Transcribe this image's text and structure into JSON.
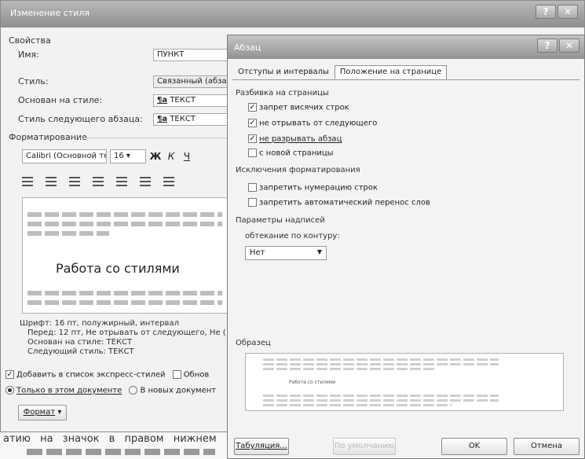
{
  "bg_dialog": {
    "title": "Изменение стиля",
    "properties_label": "Свойства",
    "name_label": "Имя:",
    "name_value": "ПУНКТ",
    "style_label": "Стиль:",
    "style_value": "Связанный (абзац",
    "based_on_label": "Основан на стиле:",
    "based_on_value": "ТЕКСТ",
    "next_style_label": "Стиль следующего абзаца:",
    "next_style_value": "ТЕКСТ",
    "formatting_label": "Форматирование",
    "font_value": "Calibri (Основной тек",
    "size_value": "16",
    "bold_label": "Ж",
    "italic_label": "К",
    "underline_label": "Ч",
    "preview_sample": "Работа со стилями",
    "desc_lines": [
      "Шрифт: 16 пт, полужирный, интервал",
      "Перед: 12 пт, Не отрывать от следующего, Не (",
      "Основан на стиле: ТЕКСТ",
      "Следующий стиль: ТЕКСТ"
    ],
    "add_to_gallery": "Добавить в список экспресс-стилей",
    "autoupdate": "Обнов",
    "only_this_doc": "Только в этом документе",
    "new_docs": "В новых документ",
    "format_button": "Формат"
  },
  "document": {
    "line1": "атию на значок в правом нижнем"
  },
  "fg_dialog": {
    "title": "Абзац",
    "tab_indents": "Отступы и интервалы",
    "tab_position": "Положение на странице",
    "pagination_label": "Разбивка на страницы",
    "widow_control": "запрет висячих строк",
    "keep_with_next": "не отрывать от следующего",
    "keep_lines_together": "не разрывать абзац",
    "page_break_before": "с новой страницы",
    "exceptions_label": "Исключения форматирования",
    "suppress_line_numbers": "запретить нумерацию строк",
    "dont_hyphenate": "запретить автоматический перенос слов",
    "textbox_label": "Параметры надписей",
    "wrap_label": "обтекание по контуру:",
    "wrap_value": "Нет",
    "sample_label": "Образец",
    "sample_text": "Работа со стилями",
    "tabulation_button": "Табуляция...",
    "default_button": "По умолчанию",
    "ok_button": "OK",
    "cancel_button": "Отмена"
  },
  "colors": {
    "titlebar": "#9a9a9a",
    "dialog_bg": "#f3f3f3"
  }
}
